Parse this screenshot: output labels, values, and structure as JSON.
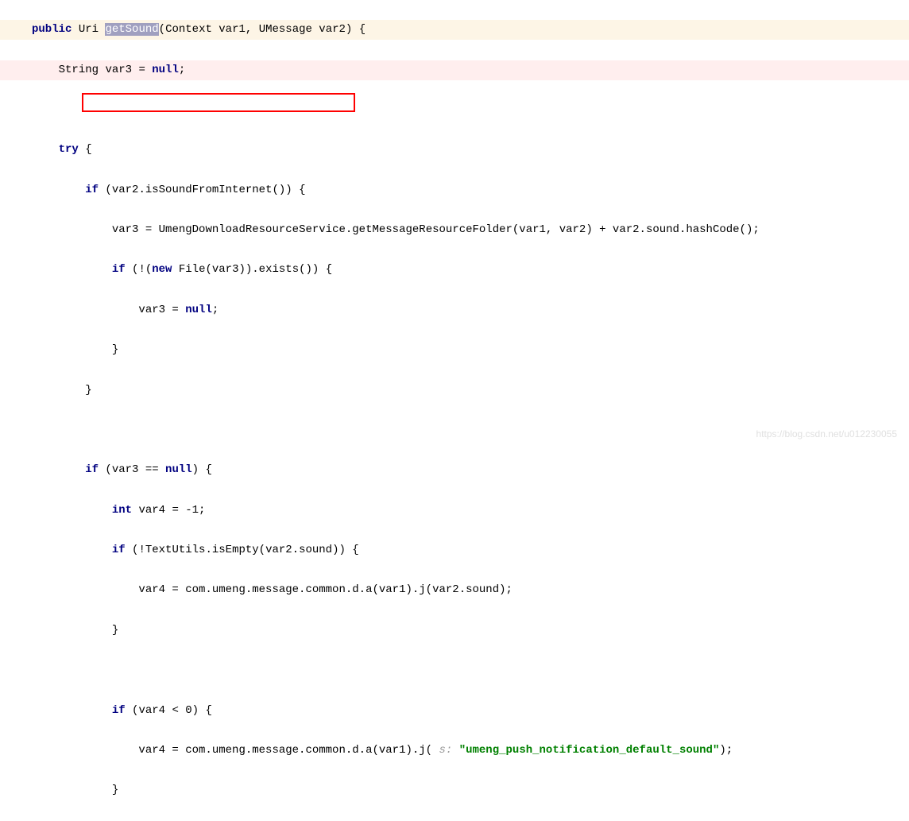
{
  "code": {
    "line1": {
      "kw_public": "public",
      "type_uri": "Uri",
      "method_name": "getSound",
      "params": "(Context var1, UMessage var2) {"
    },
    "line2": {
      "type_string": "String",
      "var": "var3 = ",
      "kw_null": "null",
      "semi": ";"
    },
    "line3": {
      "kw_try": "try",
      "brace": " {"
    },
    "line4": {
      "kw_if": "if",
      "cond": " (var2.isSoundFromInternet()) {"
    },
    "line5": {
      "text": "var3 = UmengDownloadResourceService.getMessageResourceFolder(var1, var2) + var2.sound.hashCode();"
    },
    "line6": {
      "kw_if": "if",
      "pre": " (!(",
      "kw_new": "new",
      "post": " File(var3)).exists()) {"
    },
    "line7": {
      "text": "var3 = ",
      "kw_null": "null",
      "semi": ";"
    },
    "line8": {
      "brace": "}"
    },
    "line9": {
      "brace": "}"
    },
    "line10": {
      "kw_if": "if",
      "cond": " (var3 == ",
      "kw_null": "null",
      "post": ") {"
    },
    "line11": {
      "kw_int": "int",
      "text": " var4 = -1;"
    },
    "line12": {
      "kw_if": "if",
      "cond": " (!TextUtils.isEmpty(var2.sound)) {"
    },
    "line13": {
      "text": "var4 = com.umeng.message.common.d.a(var1).j(var2.sound);"
    },
    "line14": {
      "brace": "}"
    },
    "line15": {
      "kw_if": "if",
      "cond": " (var4 < 0) {"
    },
    "line16": {
      "pre": "var4 = com.umeng.message.common.d.a(var1).j(",
      "hint": " s: ",
      "string": "\"umeng_push_notification_default_sound\"",
      "post": ");"
    },
    "line17": {
      "brace": "}"
    }
  },
  "watermark": "https://blog.csdn.net/u012230055"
}
